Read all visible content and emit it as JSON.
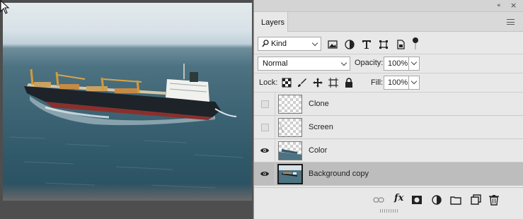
{
  "panel": {
    "tab_label": "Layers",
    "collapse_glyph": "«",
    "close_glyph": "×"
  },
  "filter": {
    "kind_label": "Kind",
    "icons": [
      "image-filter-icon",
      "adjustment-filter-icon",
      "type-filter-icon",
      "shape-filter-icon",
      "smart-object-filter-icon",
      "filter-toggle-icon"
    ]
  },
  "blend": {
    "mode": "Normal",
    "opacity_label": "Opacity:",
    "opacity_value": "100%"
  },
  "lock": {
    "label": "Lock:",
    "fill_label": "Fill:",
    "fill_value": "100%"
  },
  "layers": [
    {
      "name": "Clone",
      "visible": false,
      "thumb": "transparent"
    },
    {
      "name": "Screen",
      "visible": false,
      "thumb": "transparent-partial"
    },
    {
      "name": "Color",
      "visible": true,
      "thumb": "color"
    },
    {
      "name": "Background copy",
      "visible": true,
      "thumb": "photo",
      "selected": true
    }
  ],
  "footer_icons": [
    "link-icon",
    "fx-icon",
    "mask-icon",
    "adjustment-icon",
    "folder-icon",
    "new-layer-icon",
    "trash-icon"
  ],
  "footer": {
    "fx_label": "fx"
  },
  "colors": {
    "panel_bg": "#e8e8e8",
    "selected_row": "#bdbdbd",
    "workspace": "#535353"
  }
}
